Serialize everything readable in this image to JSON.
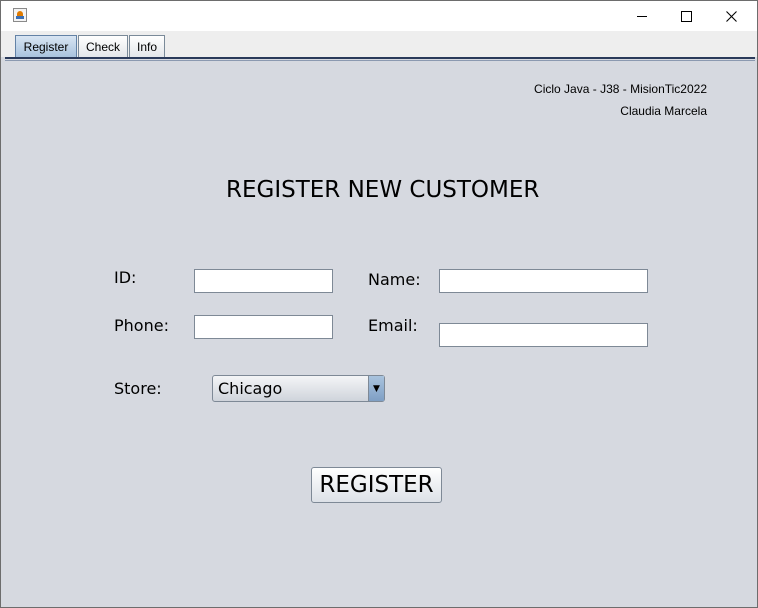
{
  "window": {
    "icon": "java-icon",
    "controls": {
      "minimize": "minimize-icon",
      "maximize": "maximize-icon",
      "close": "close-icon"
    }
  },
  "tabs": [
    {
      "label": "Register",
      "active": true
    },
    {
      "label": "Check",
      "active": false
    },
    {
      "label": "Info",
      "active": false
    }
  ],
  "credits": {
    "line1": "Ciclo Java - J38 - MisionTic2022",
    "line2": "Claudia Marcela"
  },
  "form": {
    "title": "REGISTER NEW CUSTOMER",
    "id_label": "ID:",
    "id_value": "",
    "name_label": "Name:",
    "name_value": "",
    "phone_label": "Phone:",
    "phone_value": "",
    "email_label": "Email:",
    "email_value": "",
    "store_label": "Store:",
    "store_selected": "Chicago",
    "register_label": "REGISTER"
  },
  "colors": {
    "panel_bg": "#d6d9e0",
    "active_tab": "#a9c3de"
  }
}
